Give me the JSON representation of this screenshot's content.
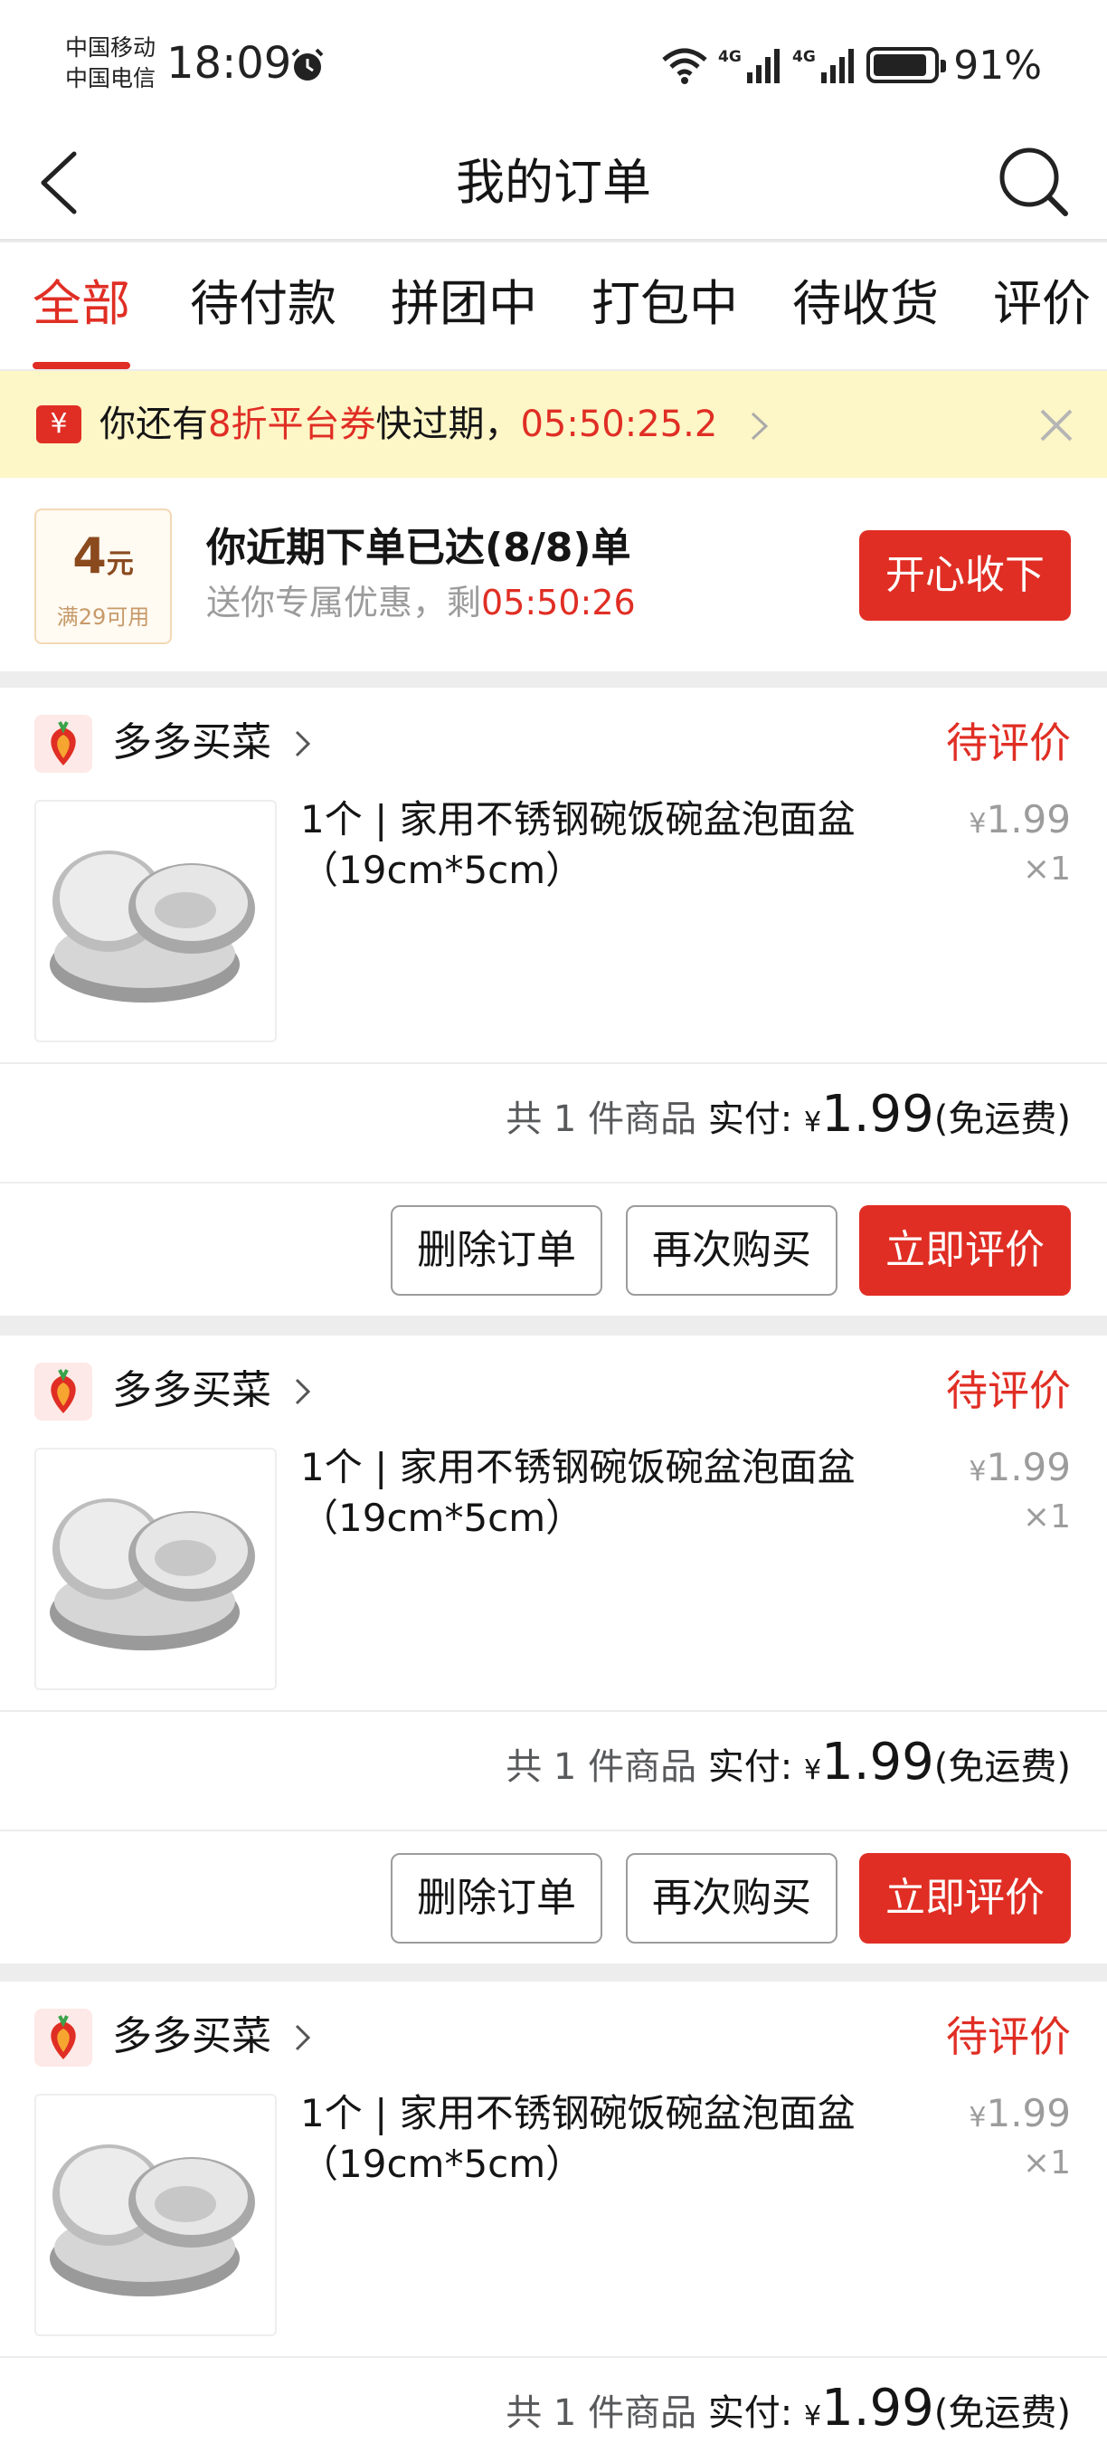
{
  "status_bar": {
    "carrier_1": "中国移动",
    "carrier_2": "中国电信",
    "time": "18:09",
    "battery": "91%",
    "net_1": "4G",
    "net_2": "4G"
  },
  "header": {
    "title": "我的订单"
  },
  "tabs": [
    {
      "label": "全部",
      "active": true
    },
    {
      "label": "待付款"
    },
    {
      "label": "拼团中"
    },
    {
      "label": "打包中"
    },
    {
      "label": "待收货"
    },
    {
      "label": "评价"
    }
  ],
  "notice": {
    "icon_glyph": "¥",
    "prefix": "你还有",
    "highlight": "8折平台券",
    "suffix": "快过期，",
    "countdown": "05:50:25.2"
  },
  "promo": {
    "coupon_amount": "4",
    "coupon_unit": "元",
    "coupon_condition": "满29可用",
    "title": "你近期下单已达(8/8)单",
    "subtitle_prefix": "送你专属优惠，剩",
    "subtitle_countdown": "05:50:26",
    "button": "开心收下"
  },
  "orders": [
    {
      "shop": "多多买菜",
      "status": "待评价",
      "item_title": "1个 | 家用不锈钢碗饭碗盆泡面盆（19cm*5cm）",
      "price_symbol": "¥",
      "price": "1.99",
      "qty": "×1",
      "count_text": "共 1 件商品",
      "paid_label": "实付:",
      "total_symbol": "¥",
      "total": "1.99",
      "shipping": "(免运费)",
      "btn_delete": "删除订单",
      "btn_rebuy": "再次购买",
      "btn_review": "立即评价"
    },
    {
      "shop": "多多买菜",
      "status": "待评价",
      "item_title": "1个 | 家用不锈钢碗饭碗盆泡面盆（19cm*5cm）",
      "price_symbol": "¥",
      "price": "1.99",
      "qty": "×1",
      "count_text": "共 1 件商品",
      "paid_label": "实付:",
      "total_symbol": "¥",
      "total": "1.99",
      "shipping": "(免运费)",
      "btn_delete": "删除订单",
      "btn_rebuy": "再次购买",
      "btn_review": "立即评价"
    },
    {
      "shop": "多多买菜",
      "status": "待评价",
      "item_title": "1个 | 家用不锈钢碗饭碗盆泡面盆（19cm*5cm）",
      "price_symbol": "¥",
      "price": "1.99",
      "qty": "×1",
      "count_text": "共 1 件商品",
      "paid_label": "实付:",
      "total_symbol": "¥",
      "total": "1.99",
      "shipping": "(免运费)"
    }
  ],
  "colors": {
    "accent": "#e02e24",
    "notice_bg": "#fdf6c7",
    "muted_text": "#9c9c9c"
  }
}
